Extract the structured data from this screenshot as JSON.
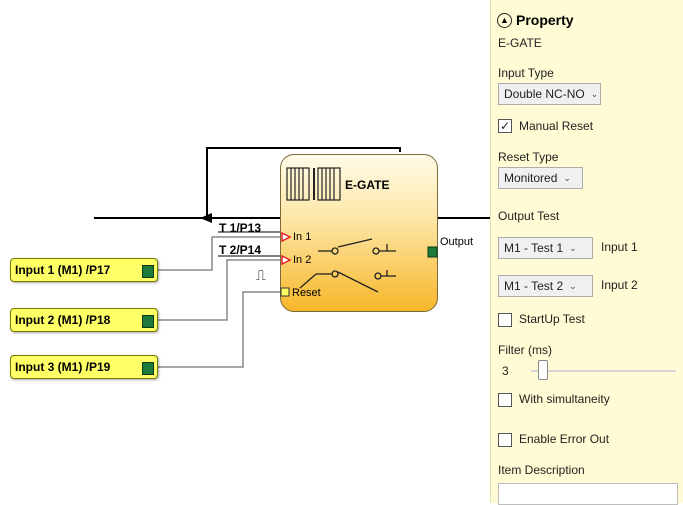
{
  "diagram": {
    "inputs": [
      {
        "label": "Input 1 (M1) /P17",
        "terminal_color": "#1e7a3a"
      },
      {
        "label": "Input 2 (M1) /P18",
        "terminal_color": "#1e7a3a"
      },
      {
        "label": "Input 3 (M1) /P19",
        "terminal_color": "#1e7a3a"
      }
    ],
    "wire_labels": {
      "t1": "T 1/P13",
      "t2": "T 2/P14",
      "reset_symbol": "⎍"
    },
    "gate": {
      "title": "E-GATE",
      "pins": {
        "in1": "In 1",
        "in2": "In 2",
        "reset": "Reset",
        "output": "Output"
      },
      "colors": {
        "top": "#fffbe8",
        "bottom": "#f7b72a"
      }
    }
  },
  "property_panel": {
    "title": "Property",
    "collapse_icon": "chevron-up-circle-icon",
    "block_name": "E-GATE",
    "input_type": {
      "label": "Input Type",
      "value": "Double NC-NO"
    },
    "manual_reset": {
      "label": "Manual Reset",
      "checked": true
    },
    "reset_type": {
      "label": "Reset Type",
      "value": "Monitored"
    },
    "output_test": {
      "label": "Output Test"
    },
    "test1": {
      "value": "M1 - Test 1",
      "label": "Input 1"
    },
    "test2": {
      "value": "M1 - Test 2",
      "label": "Input 2"
    },
    "startup_test": {
      "label": "StartUp Test",
      "checked": false
    },
    "filter": {
      "label": "Filter (ms)",
      "value": "3"
    },
    "with_simultaneity": {
      "label": "With simultaneity",
      "checked": false
    },
    "enable_error_out": {
      "label": "Enable Error Out",
      "checked": false
    },
    "item_description": {
      "label": "Item Description",
      "value": ""
    }
  }
}
